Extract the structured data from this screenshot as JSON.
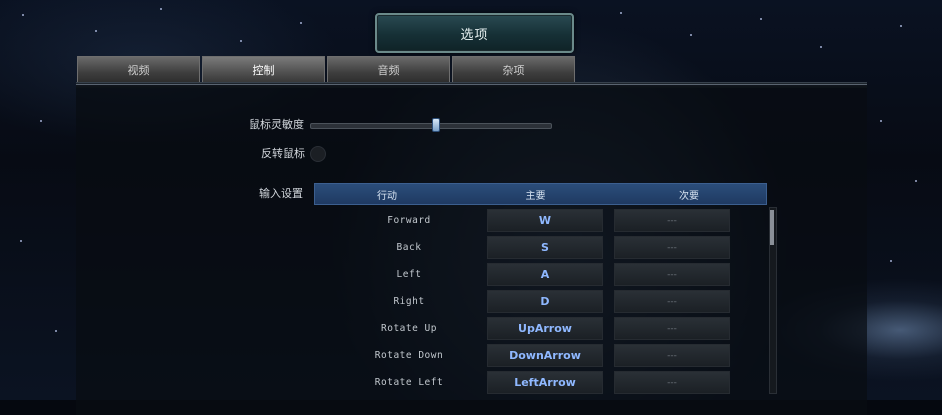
{
  "title": "选项",
  "tabs": [
    {
      "label": "视频",
      "active": false
    },
    {
      "label": "控制",
      "active": true
    },
    {
      "label": "音频",
      "active": false
    },
    {
      "label": "杂项",
      "active": false
    }
  ],
  "mouse_sensitivity": {
    "label": "鼠标灵敏度",
    "value_fraction": 0.52
  },
  "invert_mouse": {
    "label": "反转鼠标",
    "checked": false
  },
  "input_settings": {
    "label": "输入设置",
    "columns": {
      "action": "行动",
      "primary": "主要",
      "secondary": "次要"
    },
    "rows": [
      {
        "action": "Forward",
        "primary": "W",
        "secondary": "---"
      },
      {
        "action": "Back",
        "primary": "S",
        "secondary": "---"
      },
      {
        "action": "Left",
        "primary": "A",
        "secondary": "---"
      },
      {
        "action": "Right",
        "primary": "D",
        "secondary": "---"
      },
      {
        "action": "Rotate Up",
        "primary": "UpArrow",
        "secondary": "---"
      },
      {
        "action": "Rotate Down",
        "primary": "DownArrow",
        "secondary": "---"
      },
      {
        "action": "Rotate Left",
        "primary": "LeftArrow",
        "secondary": "---"
      }
    ],
    "scroll_fraction": 0.0
  },
  "colors": {
    "accent": "#8fb8ff",
    "header_blue": "#2b4d7a"
  }
}
